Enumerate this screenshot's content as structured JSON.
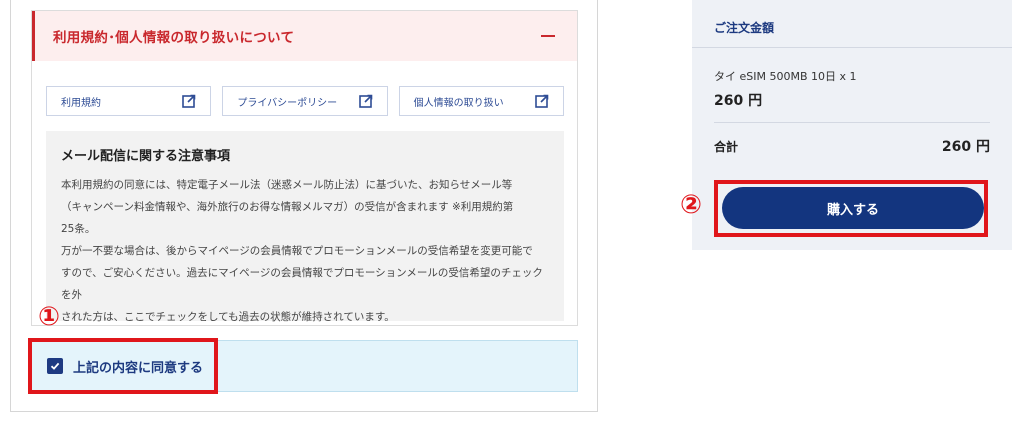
{
  "terms_section": {
    "title": "利用規約･個人情報の取り扱いについて",
    "collapse_icon": "minus-icon",
    "links": [
      {
        "label": "利用規約",
        "icon": "external-link-icon"
      },
      {
        "label": "プライバシーポリシー",
        "icon": "external-link-icon"
      },
      {
        "label": "個人情報の取り扱い",
        "icon": "external-link-icon"
      }
    ]
  },
  "notice": {
    "title": "メール配信に関する注意事項",
    "lines": [
      "本利用規約の同意には、特定電子メール法（迷惑メール防止法）に基づいた、お知らせメール等",
      "（キャンペーン料金情報や、海外旅行のお得な情報メルマガ）の受信が含まれます ※利用規約第",
      "25条。",
      "万が一不要な場合は、後からマイページの会員情報でプロモーションメールの受信希望を変更可能で",
      "すので、ご安心ください。過去にマイページの会員情報でプロモーションメールの受信希望のチェックを外",
      "された方は、ここでチェックをしても過去の状態が維持されています。"
    ]
  },
  "agree": {
    "label": "上記の内容に同意する",
    "checked": true
  },
  "order": {
    "title": "ご注文金額",
    "item_name": "タイ eSIM 500MB 10日 x 1",
    "item_price": "260 円",
    "total_label": "合計",
    "total_value": "260 円"
  },
  "buy_button": {
    "label": "購入する"
  },
  "annotations": {
    "step1": "①",
    "step2": "②"
  },
  "colors": {
    "accent_red": "#c9282d",
    "navy": "#13357f",
    "frame_red": "#e0161b",
    "agree_bg": "#e4f4fb",
    "order_bg": "#eef1f6"
  }
}
